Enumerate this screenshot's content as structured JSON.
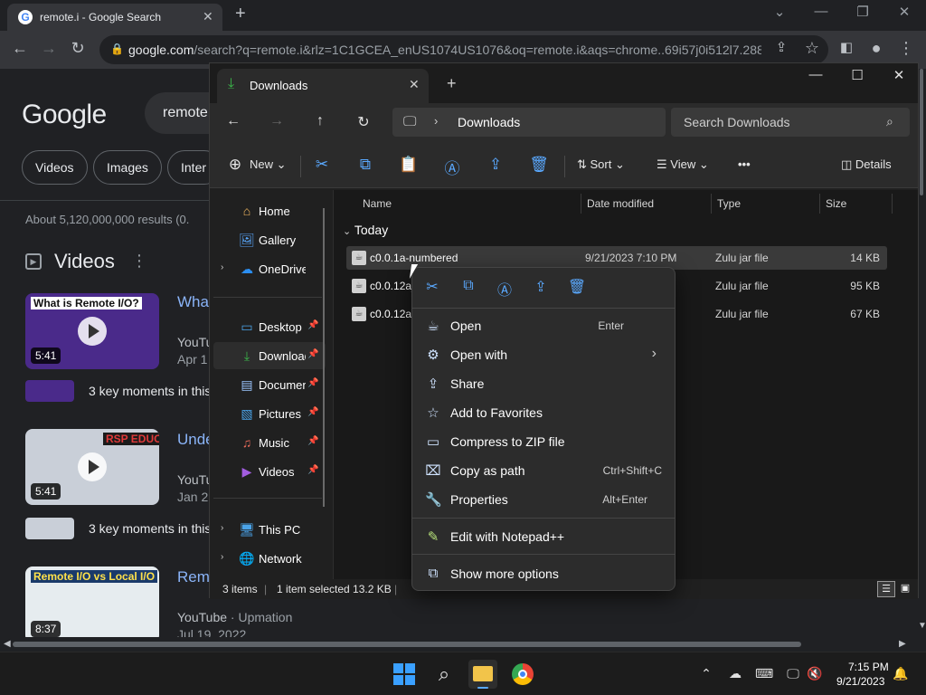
{
  "browser": {
    "tab_title": "remote.i - Google Search",
    "favicon": "G",
    "url_host": "google.com",
    "url_rest": "/search?q=remote.i&rlz=1C1GCEA_enUS1074US1076&oq=remote.i&aqs=chrome..69i57j0i512l7.288..."
  },
  "google": {
    "logo": "Google",
    "query": "remote",
    "chips": [
      "Videos",
      "Images",
      "Inter"
    ],
    "results_count": "About 5,120,000,000 results (0.",
    "videos_heading": "Videos",
    "videos": [
      {
        "thumb_caption": "What is Remote I/O?",
        "duration": "5:41",
        "title": "What",
        "source": "YouTu",
        "date": "Apr 1",
        "moments": "3 key moments in this"
      },
      {
        "thumb_caption": "RSP EDUCATION",
        "duration": "5:41",
        "title": "Unde",
        "source": "YouTu",
        "date": "Jan 2",
        "moments": "3 key moments in this"
      },
      {
        "thumb_caption": "Remote I/O vs Local I/O",
        "duration": "8:37",
        "title": "Rem",
        "source": "YouTube",
        "source_channel": "· Upmation",
        "date": "Jul 19, 2022"
      }
    ]
  },
  "explorer": {
    "tab_title": "Downloads",
    "address_location": "Downloads",
    "search_placeholder": "Search Downloads",
    "commands": {
      "new": "New",
      "sort": "Sort",
      "view": "View",
      "more": "•••",
      "details": "Details"
    },
    "nav": [
      {
        "label": "Home"
      },
      {
        "label": "Gallery"
      },
      {
        "label": "OneDrive"
      },
      {
        "label": "Desktop"
      },
      {
        "label": "Downloads"
      },
      {
        "label": "Documents"
      },
      {
        "label": "Pictures"
      },
      {
        "label": "Music"
      },
      {
        "label": "Videos"
      },
      {
        "label": "This PC"
      },
      {
        "label": "Network"
      }
    ],
    "columns": {
      "name": "Name",
      "date": "Date modified",
      "type": "Type",
      "size": "Size"
    },
    "group": "Today",
    "files": [
      {
        "name": "c0.0.1a-numbered",
        "date": "9/21/2023 7:10 PM",
        "type": "Zulu jar file",
        "size": "14 KB"
      },
      {
        "name": "c0.0.12a_",
        "date": "",
        "type": "Zulu jar file",
        "size": "95 KB"
      },
      {
        "name": "c0.0.12a-",
        "date": "",
        "type": "Zulu jar file",
        "size": "67 KB"
      }
    ],
    "status": {
      "items": "3 items",
      "selected": "1 item selected  13.2 KB"
    }
  },
  "context_menu": {
    "items": [
      {
        "label": "Open",
        "shortcut": "Enter"
      },
      {
        "label": "Open with",
        "shortcut": "›"
      },
      {
        "label": "Share",
        "shortcut": ""
      },
      {
        "label": "Add to Favorites",
        "shortcut": ""
      },
      {
        "label": "Compress to ZIP file",
        "shortcut": ""
      },
      {
        "label": "Copy as path",
        "shortcut": "Ctrl+Shift+C"
      },
      {
        "label": "Properties",
        "shortcut": "Alt+Enter"
      },
      {
        "label": "Edit with Notepad++",
        "shortcut": ""
      },
      {
        "label": "Show more options",
        "shortcut": ""
      }
    ]
  },
  "taskbar": {
    "time": "7:15 PM",
    "date": "9/21/2023"
  },
  "colors": {
    "accent_blue": "#5aa9ff",
    "download_green": "#3bb54a",
    "link_blue": "#8ab4f8"
  }
}
